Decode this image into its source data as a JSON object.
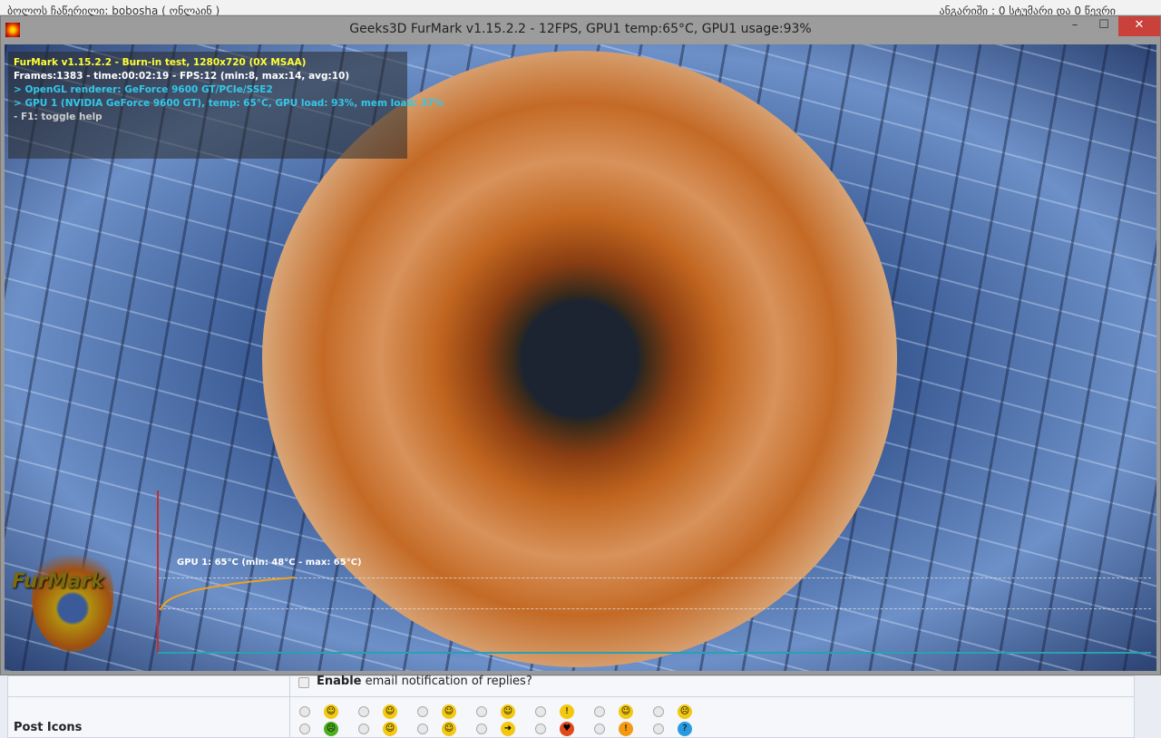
{
  "background_page": {
    "header_left": "ბოლოს ჩაწერილი: bobosha ( ონლაინ )",
    "header_right": "ანგარიში : 0 სტუმარი და 0 წევრი",
    "enable_bold": "Enable",
    "enable_rest": " email notification of replies?",
    "post_icons_label": "Post Icons"
  },
  "window": {
    "title": "Geeks3D FurMark v1.15.2.2 - 12FPS, GPU1 temp:65°C, GPU1 usage:93%",
    "minimize": "–",
    "maximize": "☐",
    "close": "✕"
  },
  "hud": {
    "line1": "FurMark v1.15.2.2 - Burn-in test, 1280x720 (0X MSAA)",
    "line2": "Frames:1383 - time:00:02:19 - FPS:12 (min:8, max:14, avg:10)",
    "line3": "> OpenGL renderer: GeForce 9600 GT/PCIe/SSE2",
    "line4": "> GPU 1 (NVIDIA GeForce 9600 GT), temp: 65°C, GPU load: 93%, mem load: 37%",
    "line5": "- F1: toggle help"
  },
  "temp_graph": {
    "label": "GPU 1: 65°C (min: 48°C - max: 65°C)",
    "current": 65,
    "min": 48,
    "max": 65
  },
  "logo_text": "FurMark",
  "emoticons": [
    {
      "glyph": "☺",
      "color": "#f2c811"
    },
    {
      "glyph": "☺",
      "color": "#f2c811"
    },
    {
      "glyph": "☺",
      "color": "#f2c811"
    },
    {
      "glyph": "☺",
      "color": "#f2c811"
    },
    {
      "glyph": "!",
      "color": "#f2c811"
    },
    {
      "glyph": "☺",
      "color": "#f2c811"
    },
    {
      "glyph": "☹",
      "color": "#f2c811"
    },
    {
      "glyph": "☹",
      "color": "#4caf20"
    },
    {
      "glyph": "☺",
      "color": "#f2c811"
    },
    {
      "glyph": "☺",
      "color": "#f2c811"
    },
    {
      "glyph": "➜",
      "color": "#f2c811"
    },
    {
      "glyph": "♥",
      "color": "#e04a1a"
    },
    {
      "glyph": "!",
      "color": "#f29a11"
    },
    {
      "glyph": "?",
      "color": "#2a9ae0"
    }
  ]
}
